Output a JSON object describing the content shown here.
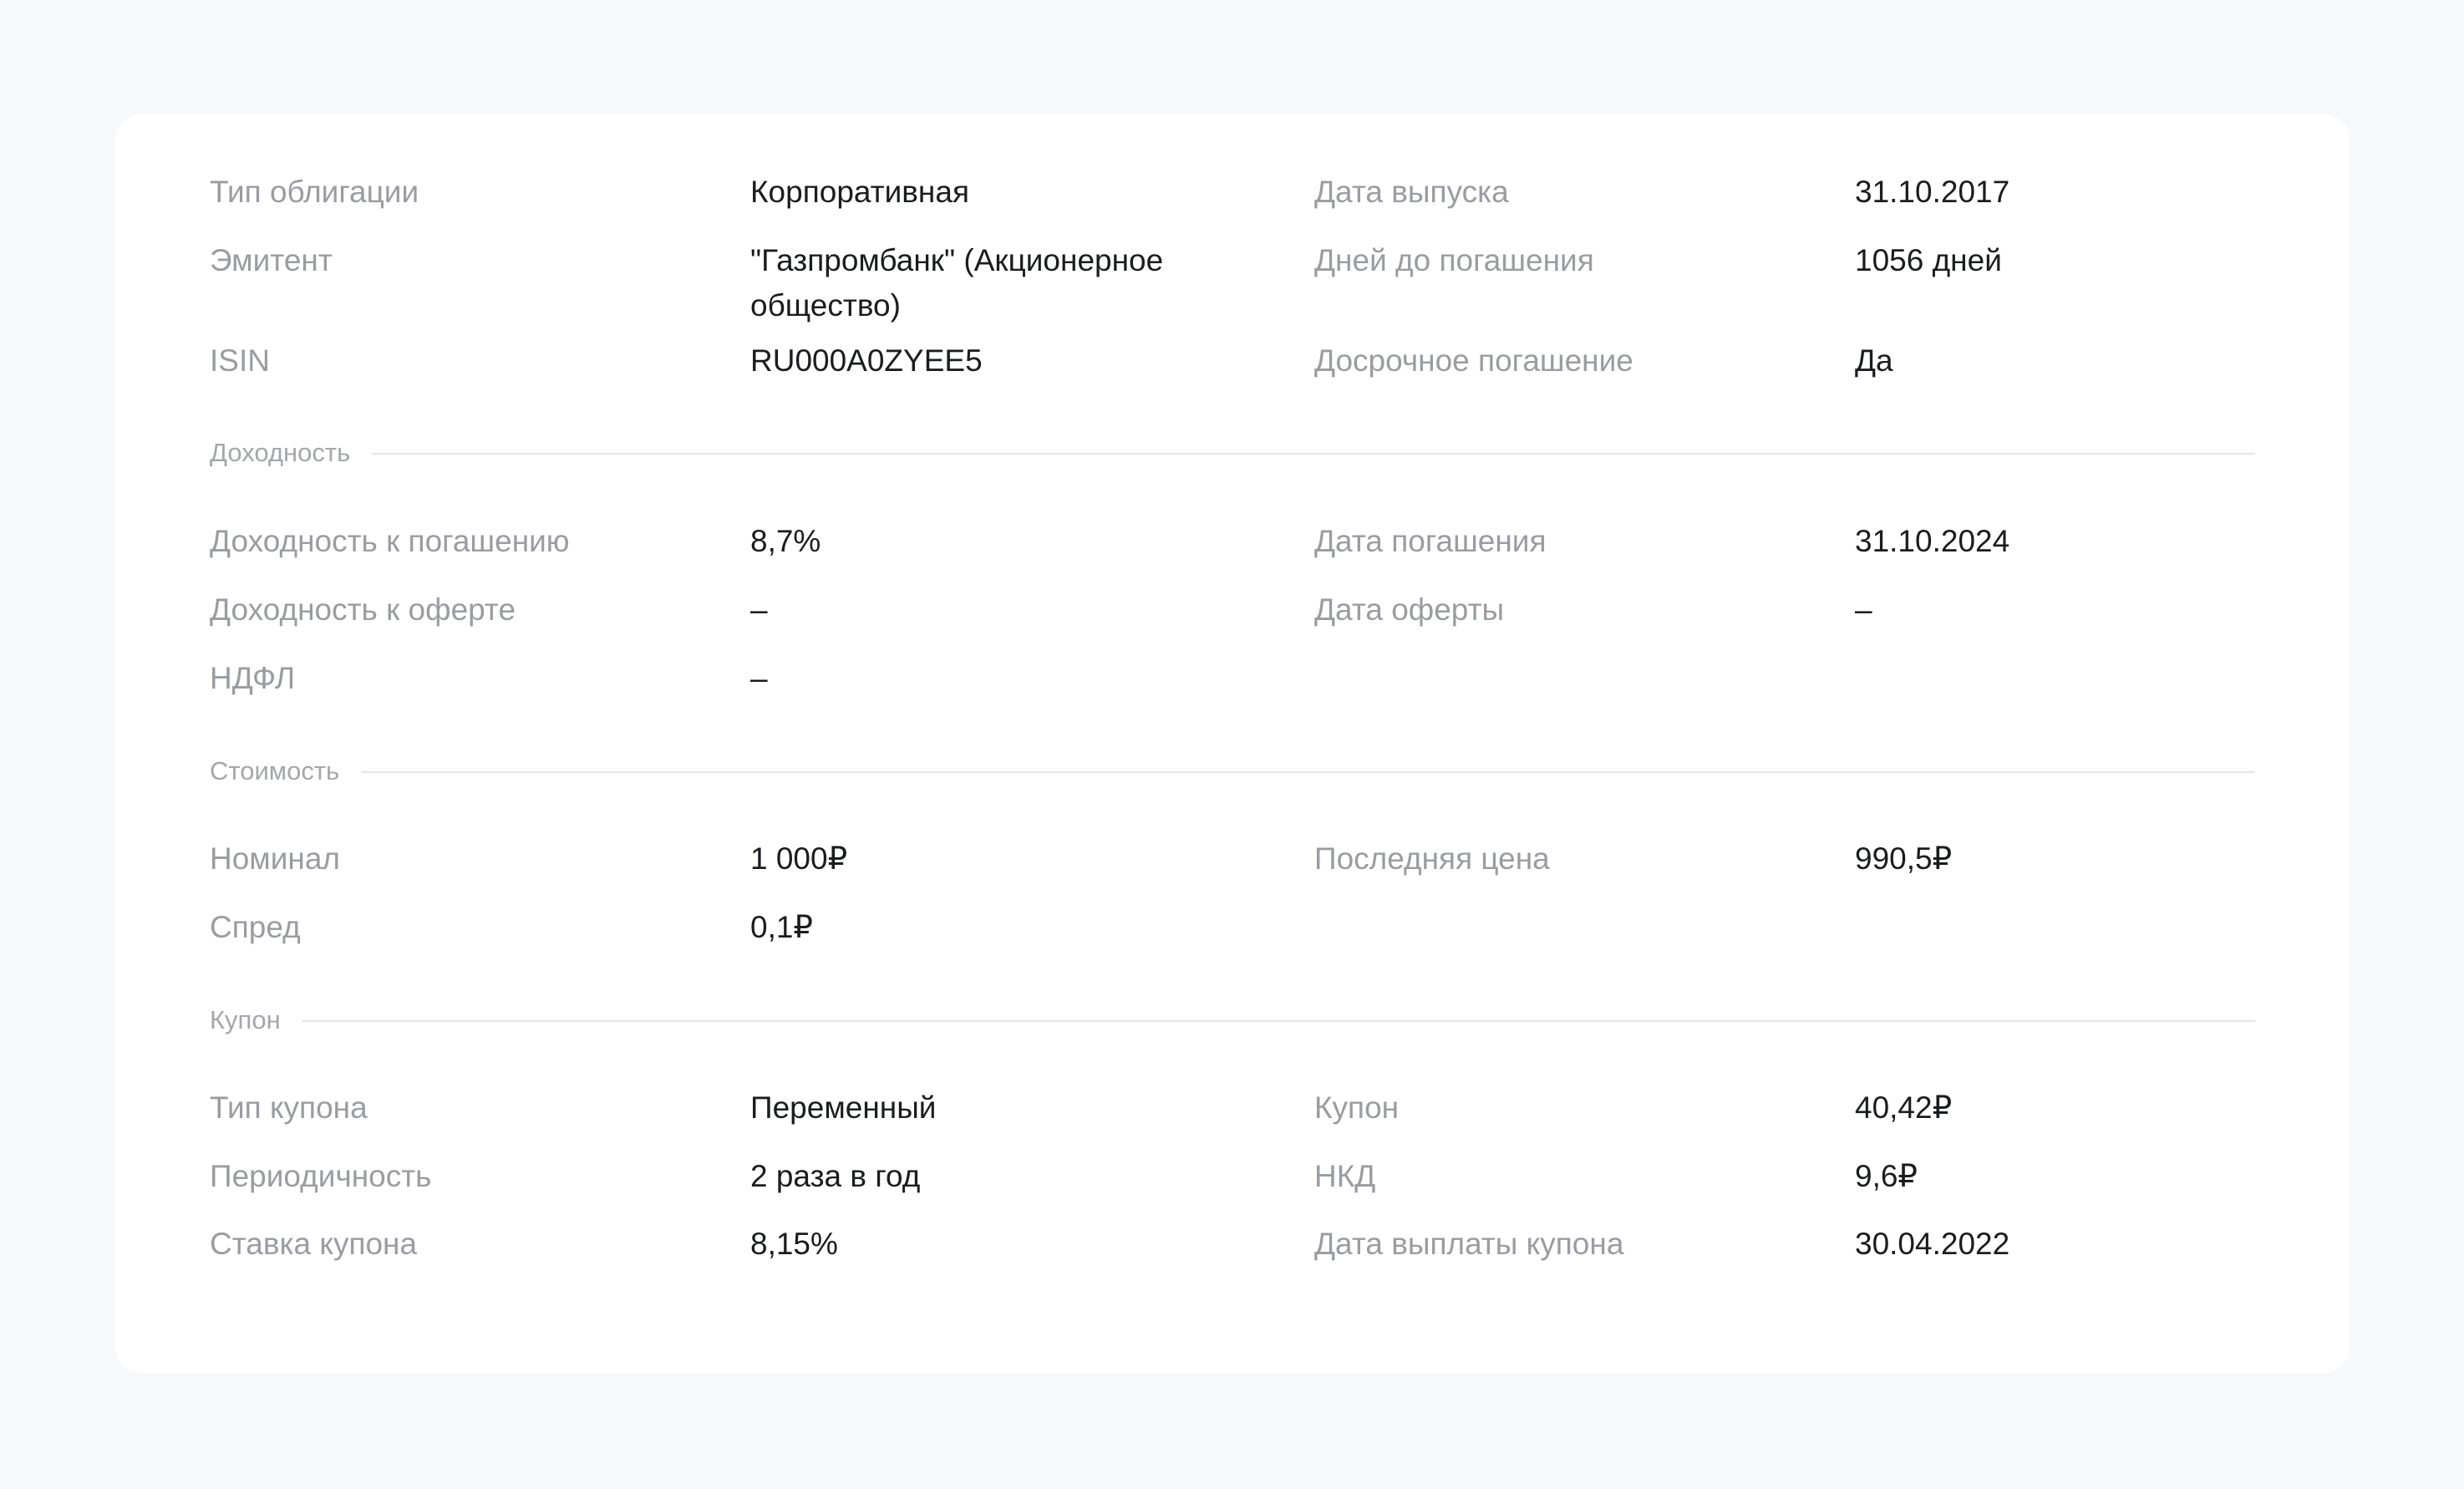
{
  "general": [
    {
      "label": "Тип облигации",
      "value": "Корпоративная",
      "label2": "Дата выпуска",
      "value2": "31.10.2017"
    },
    {
      "label": "Эмитент",
      "value": "\"Газпромбанк\" (Акционерное общество)",
      "label2": "Дней до погашения",
      "value2": "1056 дней"
    },
    {
      "label": "ISIN",
      "value": "RU000A0ZYEE5",
      "label2": "Досрочное погашение",
      "value2": "Да"
    }
  ],
  "yield": {
    "title": "Доходность",
    "rows": [
      {
        "label": "Доходность к погашению",
        "value": "8,7%",
        "label2": "Дата погашения",
        "value2": "31.10.2024"
      },
      {
        "label": "Доходность к оферте",
        "value": "–",
        "label2": "Дата оферты",
        "value2": "–"
      },
      {
        "label": "НДФЛ",
        "value": "–"
      }
    ]
  },
  "cost": {
    "title": "Стоимость",
    "rows": [
      {
        "label": "Номинал",
        "value": "1 000₽",
        "label2": "Последняя цена",
        "value2": "990,5₽"
      },
      {
        "label": "Спред",
        "value": "0,1₽"
      }
    ]
  },
  "coupon": {
    "title": "Купон",
    "rows": [
      {
        "label": "Тип купона",
        "value": "Переменный",
        "label2": "Купон",
        "value2": "40,42₽"
      },
      {
        "label": "Периодичность",
        "value": "2 раза в год",
        "label2": "НКД",
        "value2": "9,6₽"
      },
      {
        "label": "Ставка купона",
        "value": "8,15%",
        "label2": "Дата выплаты купона",
        "value2": "30.04.2022"
      }
    ]
  }
}
